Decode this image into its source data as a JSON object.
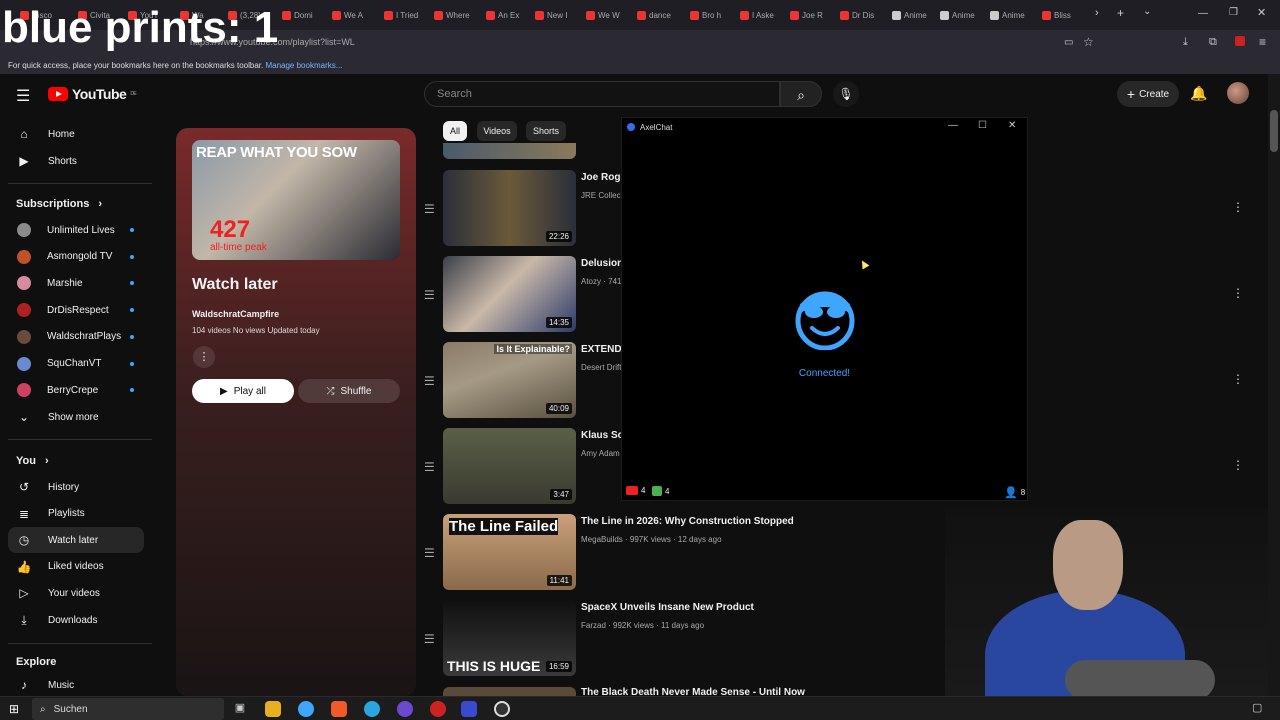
{
  "overlay": {
    "text": "blue prints: 1"
  },
  "browser": {
    "tabs": [
      "Disco",
      "Civita",
      "YouT",
      "Wa",
      "(3,28)",
      "Domi",
      "We A",
      "I Tried",
      "Where",
      "An Ex",
      "New I",
      "We W",
      "dance",
      "Bro h",
      "I Aske",
      "Joe R",
      "Dr Dis",
      "Anime",
      "Anime",
      "Anime",
      "Bliss"
    ],
    "url": "https://www.youtube.com/playlist?list=WL",
    "bookmarks_text": "For quick access, place your bookmarks here on the bookmarks toolbar.",
    "bookmarks_link": "Manage bookmarks..."
  },
  "header": {
    "logo_text": "YouTube",
    "logo_region": "DE",
    "search_placeholder": "Search",
    "create_label": "Create"
  },
  "sidebar": {
    "top": [
      {
        "label": "Home",
        "icon": "home-icon"
      },
      {
        "label": "Shorts",
        "icon": "shorts-icon"
      }
    ],
    "subscriptions_title": "Subscriptions",
    "subscriptions": [
      {
        "label": "Unlimited Lives",
        "color": "#8a8a8a"
      },
      {
        "label": "Asmongold TV",
        "color": "#c0502a"
      },
      {
        "label": "Marshie",
        "color": "#d78aa0"
      },
      {
        "label": "DrDisRespect",
        "color": "#b02020"
      },
      {
        "label": "WaldschratPlays",
        "color": "#6a4a3a"
      },
      {
        "label": "SquChanVT",
        "color": "#6a8ad0"
      },
      {
        "label": "BerryCrepe",
        "color": "#d04060"
      }
    ],
    "show_more": "Show more",
    "you_title": "You",
    "you_items": [
      {
        "label": "History",
        "icon": "history-icon"
      },
      {
        "label": "Playlists",
        "icon": "playlists-icon"
      },
      {
        "label": "Watch later",
        "icon": "clock-icon",
        "active": true
      },
      {
        "label": "Liked videos",
        "icon": "thumbs-up-icon"
      },
      {
        "label": "Your videos",
        "icon": "play-square-icon"
      },
      {
        "label": "Downloads",
        "icon": "download-icon"
      }
    ],
    "explore_title": "Explore",
    "explore_items": [
      {
        "label": "Music",
        "icon": "music-icon"
      }
    ]
  },
  "playlist": {
    "thumb_headline": "REAP WHAT YOU SOW",
    "thumb_number": "427",
    "thumb_sub": "all-time peak",
    "title": "Watch later",
    "owner": "WaldschratCampfire",
    "meta": "104 videos   No views   Updated today",
    "play_all": "Play all",
    "shuffle": "Shuffle"
  },
  "chips": [
    "All",
    "Videos",
    "Shorts"
  ],
  "videos": [
    {
      "title": "Joe Rog",
      "meta": "JRE Collect",
      "duration": "22:26",
      "thumb_bg": "linear-gradient(90deg,#2a2f3a,#6b5a3a 50%,#2a2f3a)"
    },
    {
      "title": "Delusion",
      "meta": "Atozy · 741",
      "duration": "14:35",
      "thumb_bg": "linear-gradient(135deg,#3a3f4a,#c9b8a8 45%,#2b3a6a)"
    },
    {
      "title": "EXTEND",
      "meta": "Desert Drift",
      "duration": "40:09",
      "thumb_bg": "linear-gradient(160deg,#8a7a66,#a59a85 40%,#5a5040)",
      "overlay": "Is It Explainable?"
    },
    {
      "title": "Klaus Sc",
      "meta": "Amy Adam",
      "duration": "3:47",
      "thumb_bg": "linear-gradient(180deg,#5a6048,#3a3a30)"
    },
    {
      "title": "The Line in 2026: Why Construction Stopped",
      "meta": "MegaBuilds · 997K views · 12 days ago",
      "duration": "11:41",
      "thumb_bg": "linear-gradient(180deg,#c9a07a,#8a6a4a)",
      "overlay": "The Line Failed"
    },
    {
      "title": "SpaceX Unveils Insane New Product",
      "meta": "Farzad · 992K views · 11 days ago",
      "duration": "16:59",
      "thumb_bg": "linear-gradient(180deg,#101010,#3a3a3a)",
      "overlay": "THIS IS HUGE"
    }
  ],
  "next_video_title": "The Black Death Never Made Sense - Until Now",
  "axelchat": {
    "title": "AxelChat",
    "status": "Connected!",
    "youtube_count": "4",
    "twitch_count": "4",
    "viewers": "8",
    "accent": "#3ea6ff"
  },
  "taskbar": {
    "search_label": "Suchen"
  }
}
